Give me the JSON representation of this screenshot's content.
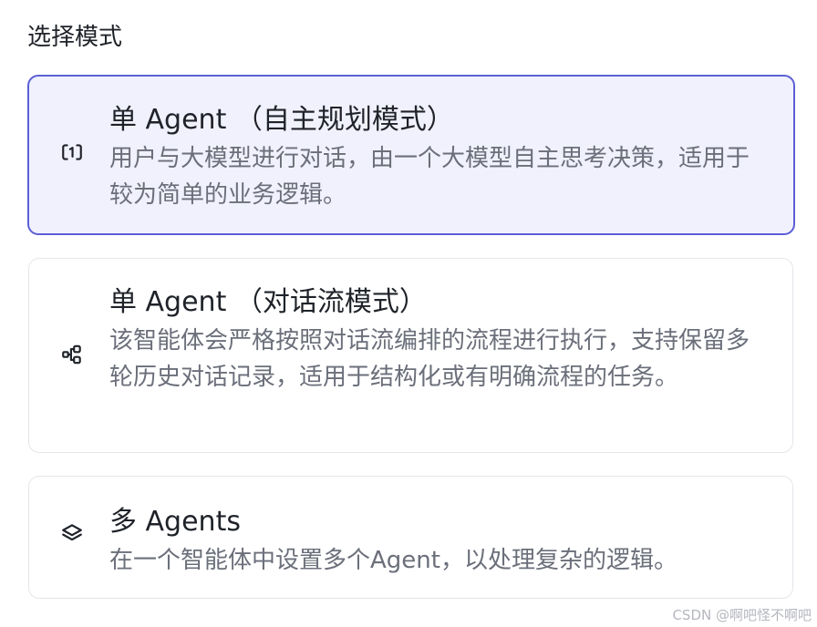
{
  "section_title": "选择模式",
  "modes": [
    {
      "title": "单 Agent （自主规划模式）",
      "description": "用户与大模型进行对话，由一个大模型自主思考决策，适用于较为简单的业务逻辑。",
      "icon": "single-agent-icon",
      "selected": true
    },
    {
      "title": "单 Agent （对话流模式）",
      "description": "该智能体会严格按照对话流编排的流程进行执行，支持保留多轮历史对话记录，适用于结构化或有明确流程的任务。",
      "icon": "workflow-icon",
      "selected": false
    },
    {
      "title": "多 Agents",
      "description": "在一个智能体中设置多个Agent，以处理复杂的逻辑。",
      "icon": "layers-icon",
      "selected": false
    }
  ],
  "colors": {
    "accent": "#5b5fd6",
    "selected_background": "#f1f1fd",
    "border": "#e5e6eb",
    "title_text": "#1f2329",
    "description_text": "#6b6f7a"
  },
  "watermark": "CSDN @啊吧怪不啊吧"
}
